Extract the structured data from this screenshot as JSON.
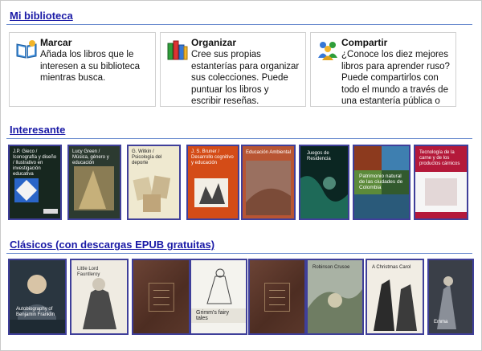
{
  "library": {
    "title": "Mi biblioteca",
    "cards": [
      {
        "title": "Marcar",
        "text": "Añada los libros que le interesen a su biblioteca mientras busca.",
        "icon": "open-book-icon"
      },
      {
        "title": "Organizar",
        "text": "Cree sus propias estanterías para organizar sus colecciones. Puede puntuar los libros y escribir reseñas.",
        "icon": "books-stack-icon"
      },
      {
        "title": "Compartir",
        "text": "¿Conoce los diez mejores libros para aprender ruso? Puede compartirlos con todo el mundo a través de una estantería pública o sencillamente informar a sus",
        "icon": "people-icon"
      }
    ]
  },
  "interesting": {
    "title": "Interesante",
    "books": [
      {
        "cover_text": "J.P. Gieco / Iconografía y diseño / Ilustrativo en investigación educativa",
        "bg": "#1f3a2d"
      },
      {
        "cover_text": "Lucy Green / Música, género y educación",
        "bg": "#3a4a3c"
      },
      {
        "cover_text": "G. Witkin / Psicología del deporte",
        "bg": "#e9e3c9"
      },
      {
        "cover_text": "J. S. Bruner / Desarrollo cognitivo y educación",
        "bg": "#d44c17"
      },
      {
        "cover_text": "Educación Ambiental",
        "bg": "#c8613a"
      },
      {
        "cover_text": "Juegos de Residencia",
        "bg": "#0e2e2a"
      },
      {
        "cover_text": "Patrimonio natural de las ciudades de Colombia",
        "bg": "#2c5f6e"
      },
      {
        "cover_text": "Tecnología de la carne y de los productos cárnicos",
        "bg": "#b4193a"
      }
    ]
  },
  "classics": {
    "title": "Clásicos (con descargas EPUB gratuitas)",
    "books": [
      {
        "cover_text": "Autobiography of Benjamin Franklin",
        "bg": "#31404c"
      },
      {
        "cover_text": "Little Lord Fauntleroy",
        "bg": "#e8e4dc"
      },
      {
        "cover_text": "",
        "bg": "#5a372a"
      },
      {
        "cover_text": "Grimm's fairy tales",
        "bg": "#f0efe8"
      },
      {
        "cover_text": "",
        "bg": "#5a372a"
      },
      {
        "cover_text": "Robinson Crusoe",
        "bg": "#9aa79b"
      },
      {
        "cover_text": "A Christmas Carol",
        "bg": "#2c3140"
      },
      {
        "cover_text": "Emma",
        "bg": "#3a3f48"
      }
    ]
  }
}
